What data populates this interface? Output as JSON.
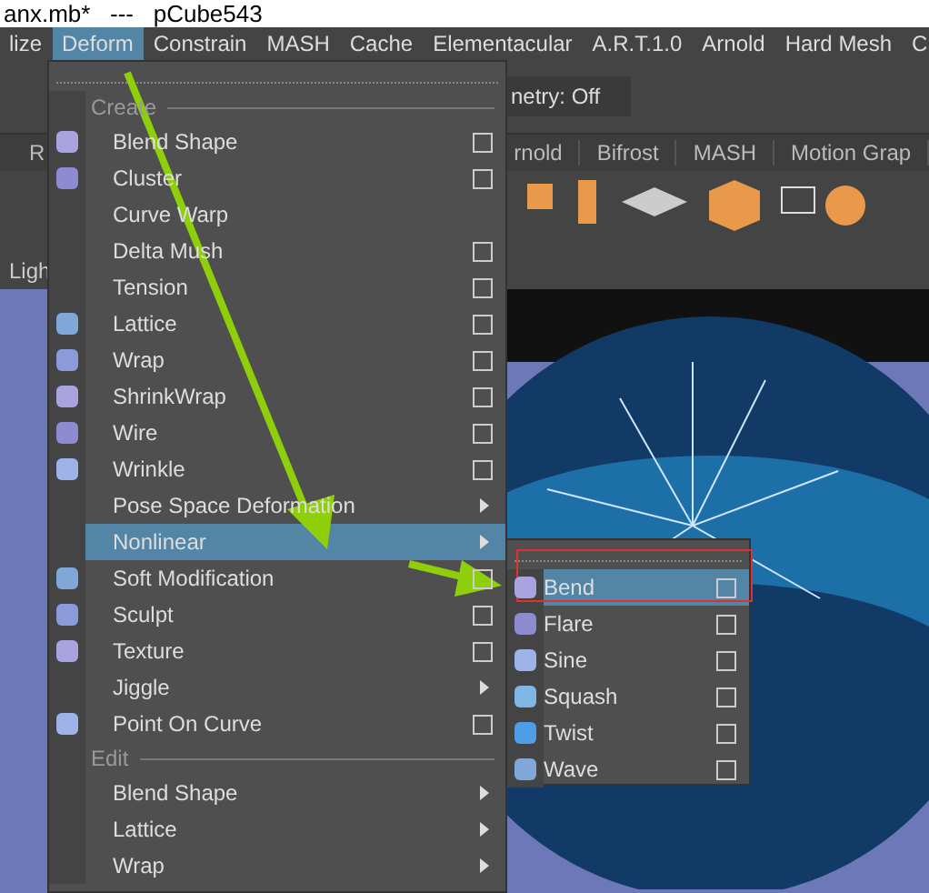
{
  "window": {
    "title": "anx.mb*   ---   pCube543"
  },
  "menubar": [
    {
      "label": "lize",
      "selected": false
    },
    {
      "label": "Deform",
      "selected": true
    },
    {
      "label": "Constrain",
      "selected": false
    },
    {
      "label": "MASH",
      "selected": false
    },
    {
      "label": "Cache",
      "selected": false
    },
    {
      "label": "Elementacular",
      "selected": false
    },
    {
      "label": "A.R.T.1.0",
      "selected": false
    },
    {
      "label": "Arnold",
      "selected": false
    },
    {
      "label": "Hard Mesh",
      "selected": false
    },
    {
      "label": "C",
      "selected": false
    }
  ],
  "toolbar": {
    "symmetry_field": "netry: Off"
  },
  "shelf_tabs": [
    {
      "label": "R"
    },
    {
      "label": "rnold"
    },
    {
      "label": "Bifrost"
    },
    {
      "label": "MASH"
    },
    {
      "label": "Motion Grap"
    }
  ],
  "panel_menu": {
    "label": "Ligh"
  },
  "menu": {
    "sections": [
      {
        "header": "Create",
        "items": [
          {
            "label": "Blend Shape",
            "kind": "option",
            "has_icon": true,
            "selected": false
          },
          {
            "label": "Cluster",
            "kind": "option",
            "has_icon": true,
            "selected": false
          },
          {
            "label": "Curve Warp",
            "kind": "plain",
            "has_icon": false,
            "selected": false
          },
          {
            "label": "Delta Mush",
            "kind": "option",
            "has_icon": false,
            "selected": false
          },
          {
            "label": "Tension",
            "kind": "option",
            "has_icon": false,
            "selected": false
          },
          {
            "label": "Lattice",
            "kind": "option",
            "has_icon": true,
            "selected": false
          },
          {
            "label": "Wrap",
            "kind": "option",
            "has_icon": true,
            "selected": false
          },
          {
            "label": "ShrinkWrap",
            "kind": "option",
            "has_icon": true,
            "selected": false
          },
          {
            "label": "Wire",
            "kind": "option",
            "has_icon": true,
            "selected": false
          },
          {
            "label": "Wrinkle",
            "kind": "option",
            "has_icon": true,
            "selected": false
          },
          {
            "label": "Pose Space Deformation",
            "kind": "submenu",
            "has_icon": false,
            "selected": false
          },
          {
            "label": "Nonlinear",
            "kind": "submenu",
            "has_icon": false,
            "selected": true
          },
          {
            "label": "Soft Modification",
            "kind": "option",
            "has_icon": true,
            "selected": false
          },
          {
            "label": "Sculpt",
            "kind": "option",
            "has_icon": true,
            "selected": false
          },
          {
            "label": "Texture",
            "kind": "option",
            "has_icon": true,
            "selected": false
          },
          {
            "label": "Jiggle",
            "kind": "submenu",
            "has_icon": false,
            "selected": false
          },
          {
            "label": "Point On Curve",
            "kind": "option",
            "has_icon": true,
            "selected": false
          }
        ]
      },
      {
        "header": "Edit",
        "items": [
          {
            "label": "Blend Shape",
            "kind": "submenu",
            "has_icon": false,
            "selected": false
          },
          {
            "label": "Lattice",
            "kind": "submenu",
            "has_icon": false,
            "selected": false
          },
          {
            "label": "Wrap",
            "kind": "submenu",
            "has_icon": false,
            "selected": false
          }
        ]
      }
    ]
  },
  "submenu": {
    "items": [
      {
        "label": "Bend",
        "kind": "option",
        "selected": true
      },
      {
        "label": "Flare",
        "kind": "option",
        "selected": false
      },
      {
        "label": "Sine",
        "kind": "option",
        "selected": false
      },
      {
        "label": "Squash",
        "kind": "option",
        "selected": false
      },
      {
        "label": "Twist",
        "kind": "option",
        "selected": false
      },
      {
        "label": "Wave",
        "kind": "option",
        "selected": false
      }
    ]
  }
}
